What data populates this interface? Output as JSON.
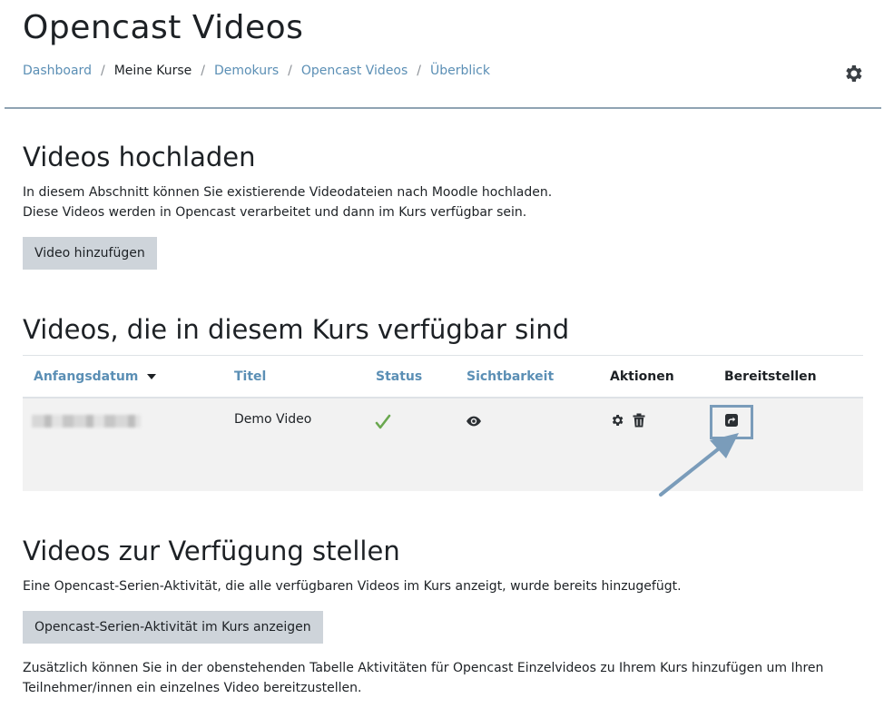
{
  "header": {
    "title": "Opencast Videos",
    "breadcrumb": [
      {
        "label": "Dashboard",
        "link": true
      },
      {
        "label": "Meine Kurse",
        "link": false
      },
      {
        "label": "Demokurs",
        "link": true
      },
      {
        "label": "Opencast Videos",
        "link": true
      },
      {
        "label": "Überblick",
        "link": true
      }
    ],
    "separator": "/",
    "settings_icon": "gear-icon"
  },
  "upload": {
    "heading": "Videos hochladen",
    "line1": "In diesem Abschnitt können Sie existierende Videodateien nach Moodle hochladen.",
    "line2": "Diese Videos werden in Opencast verarbeitet und dann im Kurs verfügbar sein.",
    "button_label": "Video hinzufügen"
  },
  "videos": {
    "heading": "Videos, die in diesem Kurs verfügbar sind",
    "columns": {
      "start_date": "Anfangsdatum",
      "title": "Titel",
      "status": "Status",
      "visibility": "Sichtbarkeit",
      "actions": "Aktionen",
      "provide": "Bereitstellen"
    },
    "rows": [
      {
        "title": "Demo Video",
        "status_icon": "check-icon",
        "visibility_icon": "eye-icon",
        "action_icons": [
          "gear-icon",
          "trash-icon"
        ],
        "provide_icon": "share-icon"
      }
    ],
    "colors": {
      "link": "#5b8fb5",
      "check": "#6aa84f",
      "highlight": "#7a9cba"
    }
  },
  "provide": {
    "heading": "Videos zur Verfügung stellen",
    "line1": "Eine Opencast-Serien-Aktivität, die alle verfügbaren Videos im Kurs anzeigt, wurde bereits hinzugefügt.",
    "button_label": "Opencast-Serien-Aktivität im Kurs anzeigen",
    "line2": "Zusätzlich können Sie in der obenstehenden Tabelle Aktivitäten für Opencast Einzelvideos zu Ihrem Kurs hinzufügen um Ihren",
    "line3": "Teilnehmer/innen ein einzelnes Video bereitzustellen."
  }
}
